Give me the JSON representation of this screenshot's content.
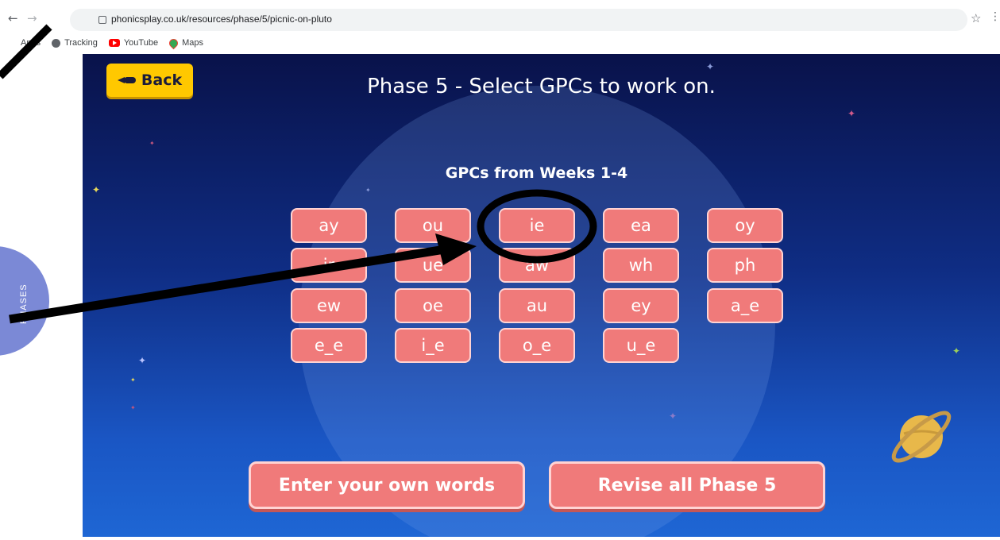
{
  "browser": {
    "url": "phonicsplay.co.uk/resources/phase/5/picnic-on-pluto",
    "bookmarks": [
      "Apps",
      "Tracking",
      "YouTube",
      "Maps"
    ]
  },
  "game": {
    "back_label": "Back",
    "title": "Phase 5 - Select GPCs to work on.",
    "subtitle": "GPCs from Weeks 1-4",
    "gpcs": [
      "ay",
      "ou",
      "ie",
      "ea",
      "oy",
      "ir",
      "ue",
      "aw",
      "wh",
      "ph",
      "ew",
      "oe",
      "au",
      "ey",
      "a_e",
      "e_e",
      "i_e",
      "o_e",
      "u_e"
    ],
    "enter_words_label": "Enter your own words",
    "revise_label": "Revise all Phase 5",
    "phases_tab": "PHASES"
  },
  "colors": {
    "button": "#f07a7a",
    "back_button": "#ffc800",
    "sky_top": "#09124a",
    "sky_bottom": "#1e66d4",
    "phases_tab": "#7b89d6"
  }
}
